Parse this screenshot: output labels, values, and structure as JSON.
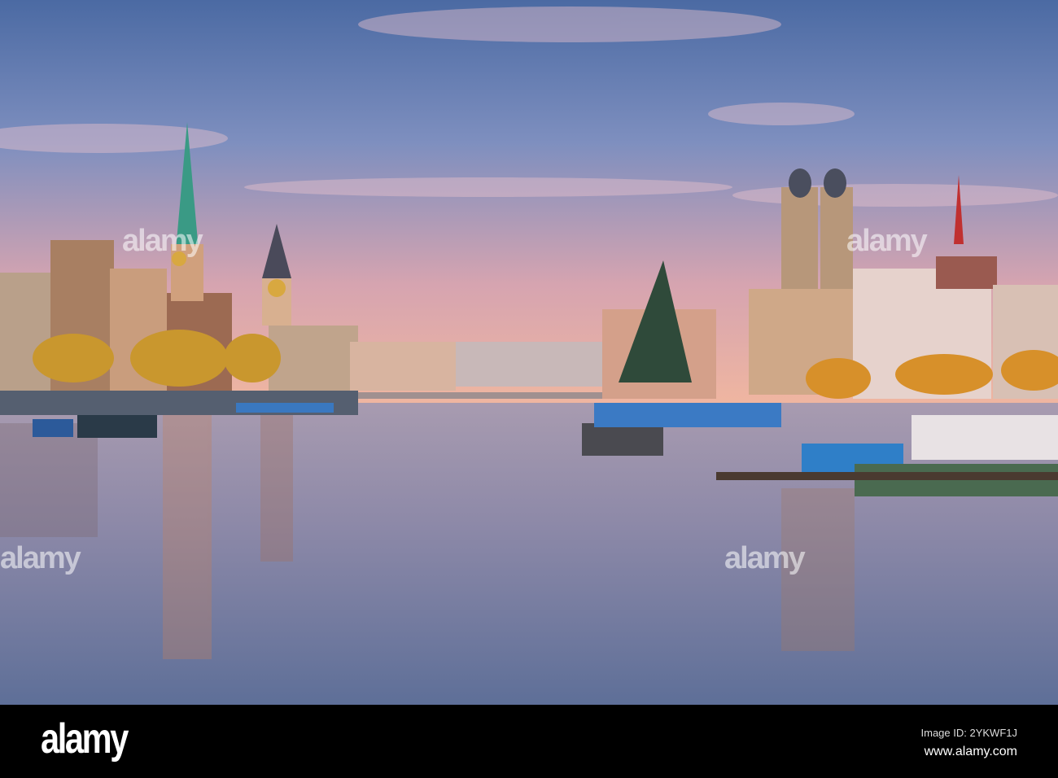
{
  "watermark": {
    "logo": "alamy",
    "image_id": "Image ID: 2YKWF1J",
    "url": "www.alamy.com"
  },
  "colors": {
    "sky_top": "#4b6aa3",
    "sky_horizon": "#e9aea6",
    "water_top": "#a08fa8",
    "water_bottom": "#5e6f98"
  }
}
